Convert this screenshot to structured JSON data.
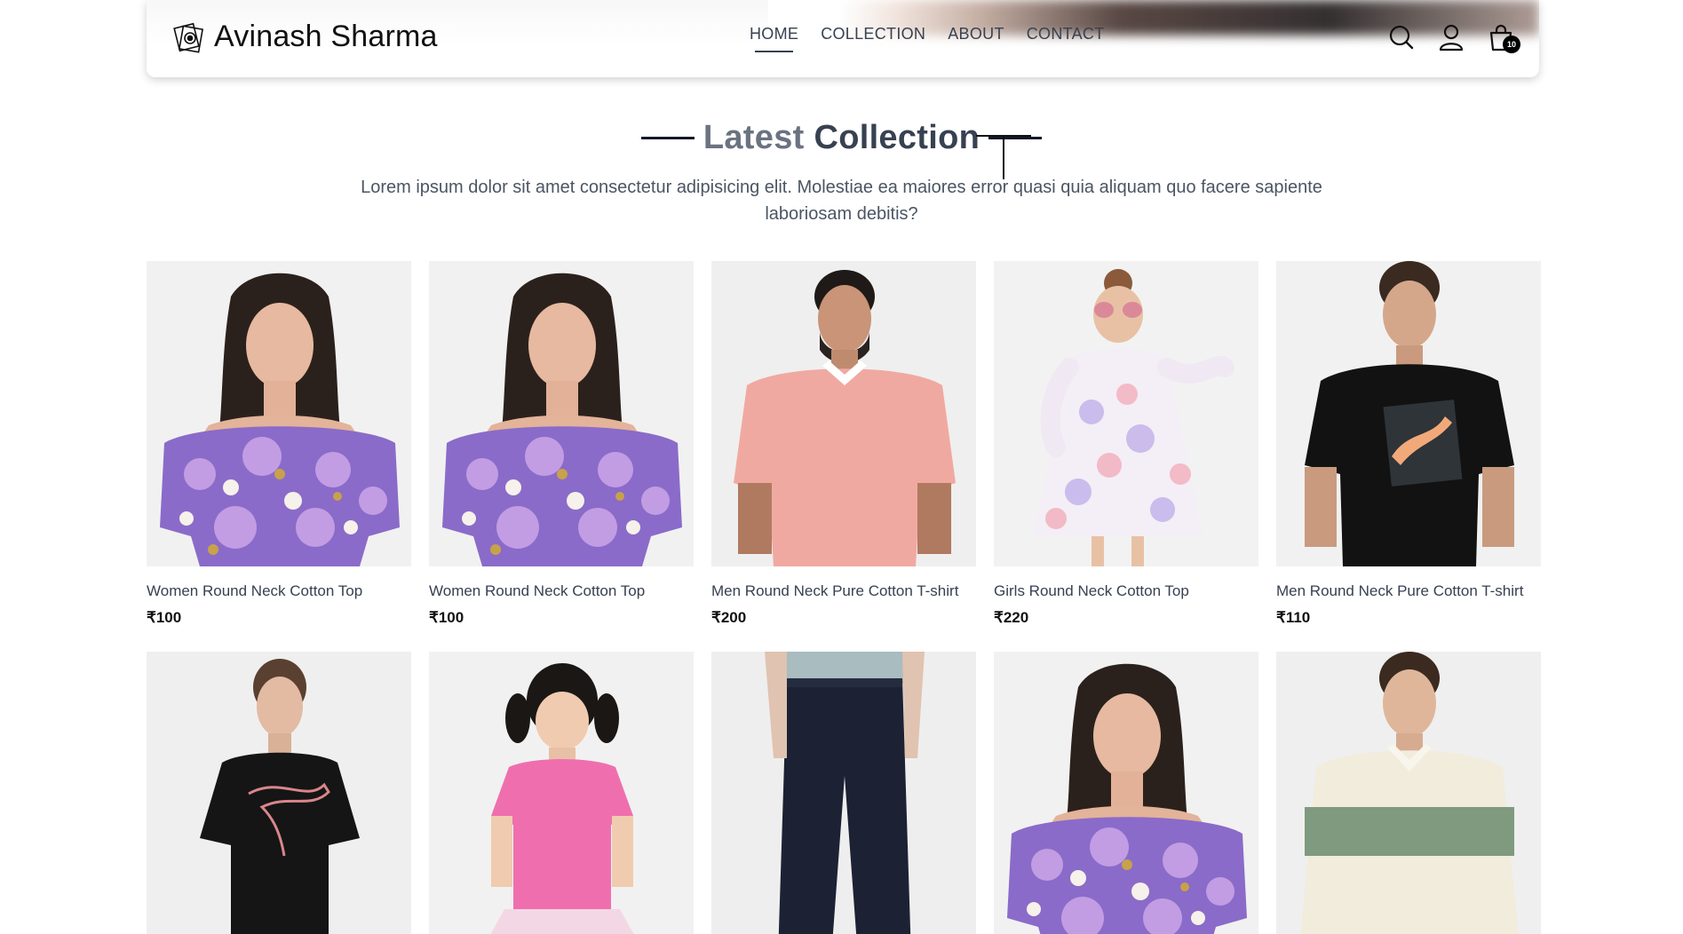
{
  "brand": {
    "name": "Avinash Sharma",
    "icon": "camera-logo-icon"
  },
  "nav": {
    "items": [
      {
        "label": "HOME",
        "active": true
      },
      {
        "label": "COLLECTION",
        "active": false
      },
      {
        "label": "ABOUT",
        "active": false
      },
      {
        "label": "CONTACT",
        "active": false
      }
    ]
  },
  "icons": {
    "search": "search-icon",
    "profile": "user-icon",
    "cart": "shopping-bag-icon"
  },
  "cart": {
    "count": "10"
  },
  "section": {
    "title_light": "Latest",
    "title_bold": "Collection",
    "description": "Lorem ipsum dolor sit amet consectetur adipisicing elit. Molestiae ea maiores error quasi quia aliquam quo facere sapiente laboriosam debitis?"
  },
  "products": [
    {
      "name": "Women Round Neck Cotton Top",
      "price": "₹100",
      "art": "woman-floral"
    },
    {
      "name": "Women Round Neck Cotton Top",
      "price": "₹100",
      "art": "woman-floral"
    },
    {
      "name": "Men Round Neck Pure Cotton T-shirt",
      "price": "₹200",
      "art": "man-pink"
    },
    {
      "name": "Girls Round Neck Cotton Top",
      "price": "₹220",
      "art": "girl-dress"
    },
    {
      "name": "Men Round Neck Pure Cotton T-shirt",
      "price": "₹110",
      "art": "man-black"
    },
    {
      "name": "",
      "price": "",
      "art": "woman-black"
    },
    {
      "name": "",
      "price": "",
      "art": "girl-pink"
    },
    {
      "name": "",
      "price": "",
      "art": "man-jeans"
    },
    {
      "name": "",
      "price": "",
      "art": "woman-floral"
    },
    {
      "name": "",
      "price": "",
      "art": "man-sweater"
    }
  ],
  "colors": {
    "text": "#374151",
    "title_light": "#6b7280",
    "accent": "#000000",
    "image_bg": "#f3f3f3"
  }
}
